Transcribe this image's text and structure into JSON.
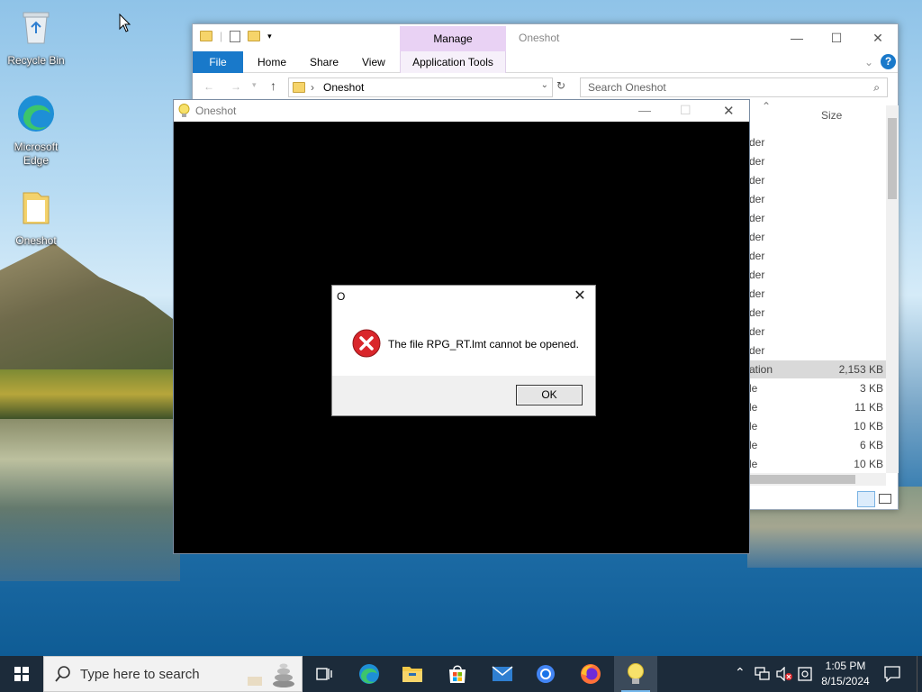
{
  "desktop": {
    "icons": [
      {
        "label": "Recycle Bin"
      },
      {
        "label": "Microsoft Edge"
      },
      {
        "label": "Oneshot"
      }
    ]
  },
  "explorer": {
    "title": "Oneshot",
    "manage_tab": "Manage",
    "tabs": [
      "File",
      "Home",
      "Share",
      "View",
      "Application Tools"
    ],
    "address": "Oneshot",
    "search_placeholder": "Search Oneshot",
    "column_size": "Size",
    "rows": [
      {
        "name": "der",
        "size": ""
      },
      {
        "name": "der",
        "size": ""
      },
      {
        "name": "der",
        "size": ""
      },
      {
        "name": "der",
        "size": ""
      },
      {
        "name": "der",
        "size": ""
      },
      {
        "name": "der",
        "size": ""
      },
      {
        "name": "der",
        "size": ""
      },
      {
        "name": "der",
        "size": ""
      },
      {
        "name": "der",
        "size": ""
      },
      {
        "name": "der",
        "size": ""
      },
      {
        "name": "der",
        "size": ""
      },
      {
        "name": "der",
        "size": ""
      },
      {
        "name": "ation",
        "size": "2,153 KB"
      },
      {
        "name": "le",
        "size": "3 KB"
      },
      {
        "name": "le",
        "size": "11 KB"
      },
      {
        "name": "le",
        "size": "10 KB"
      },
      {
        "name": "le",
        "size": "6 KB"
      },
      {
        "name": "le",
        "size": "10 KB"
      }
    ]
  },
  "game": {
    "title": "Oneshot"
  },
  "dialog": {
    "title": "O",
    "message": "The file RPG_RT.lmt cannot be opened.",
    "ok_label": "OK",
    "close_glyph": "✕"
  },
  "taskbar": {
    "search_placeholder": "Type here to search",
    "time": "1:05 PM",
    "date": "8/15/2024"
  },
  "colors": {
    "accent": "#1979ca",
    "manage_tab": "#e9d2f4",
    "taskbar": "#1c2b3a",
    "error_red": "#d9262b"
  }
}
